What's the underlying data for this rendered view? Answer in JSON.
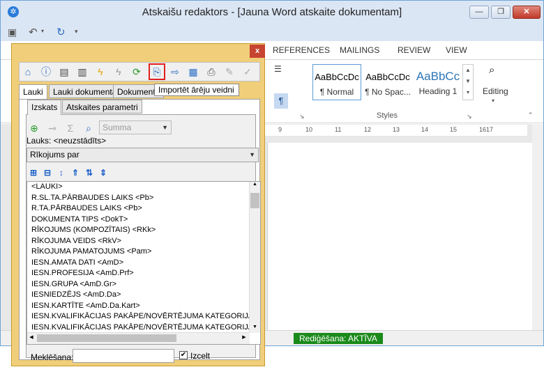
{
  "window": {
    "title": "Atskaišu redaktors  - [Jauna Word atskaite dokumentam]",
    "minimize_glyph": "—",
    "restore_glyph": "❐",
    "close_glyph": "✕"
  },
  "quick_access": {
    "save_icon": "save-icon",
    "undo_icon": "undo-icon",
    "redo_icon": "redo-icon"
  },
  "ribbon": {
    "tabs": [
      "REFERENCES",
      "MAILINGS",
      "REVIEW",
      "VIEW"
    ],
    "styles": [
      {
        "sample": "AaBbCcDc",
        "name": "¶ Normal"
      },
      {
        "sample": "AaBbCcDc",
        "name": "¶ No Spac..."
      },
      {
        "sample": "AaBbCc",
        "name": "Heading 1"
      }
    ],
    "styles_group_label": "Styles",
    "editing_label": "Editing",
    "heading_color": "#2e74b5"
  },
  "ruler_ticks": [
    "9",
    "10",
    "11",
    "12",
    "13",
    "14",
    "15",
    "16",
    "17"
  ],
  "status": {
    "editing": "Rediģēšana: AKTĪVA",
    "edit_color": "#1a8a1a"
  },
  "dialog": {
    "close_glyph": "x",
    "tooltip": "Importēt ārēju veidni",
    "outer_tabs": [
      "Lauki",
      "Lauki dokumentā",
      "Dokuments"
    ],
    "inner_tabs": [
      "Izskats",
      "Atskaites parametri"
    ],
    "summa_placeholder": "Summa",
    "lauki_label": "Lauks: <neuzstādīts>",
    "combo_value": "Rīkojums par",
    "fields": [
      "<LAUKI>",
      "R.SL.TA.PĀRBAUDES LAIKS <Pb>",
      "R.TA.PĀRBAUDES LAIKS <Pb>",
      "DOKUMENTA TIPS <DokT>",
      "RĪKOJUMS (KOMPOZĪTAIS) <RKk>",
      "RĪKOJUMA VEIDS <RkV>",
      "RĪKOJUMA PAMATOJUMS <Pam>",
      "IESN.AMATA DATI <AmD>",
      "IESN.PROFESIJA <AmD.Prf>",
      "IESN.GRUPA <AmD.Gr>",
      "IESNIEDZĒJS <AmD.Da>",
      "IESN.KARTĪTE <AmD.Da.Kart>",
      "IESN.KVALIFIKĀCIJAS PAKĀPE/NOVĒRTĒJUMA KATEGORIJA PER",
      "IESN.KVALIFIKĀCIJAS PAKĀPE/NOVĒRTĒJUMA KATEGORIJA <A"
    ],
    "search_label": "Meklēšana:",
    "search_value": "",
    "highlight_label": "Izcelt",
    "highlight_checked": "✔"
  }
}
